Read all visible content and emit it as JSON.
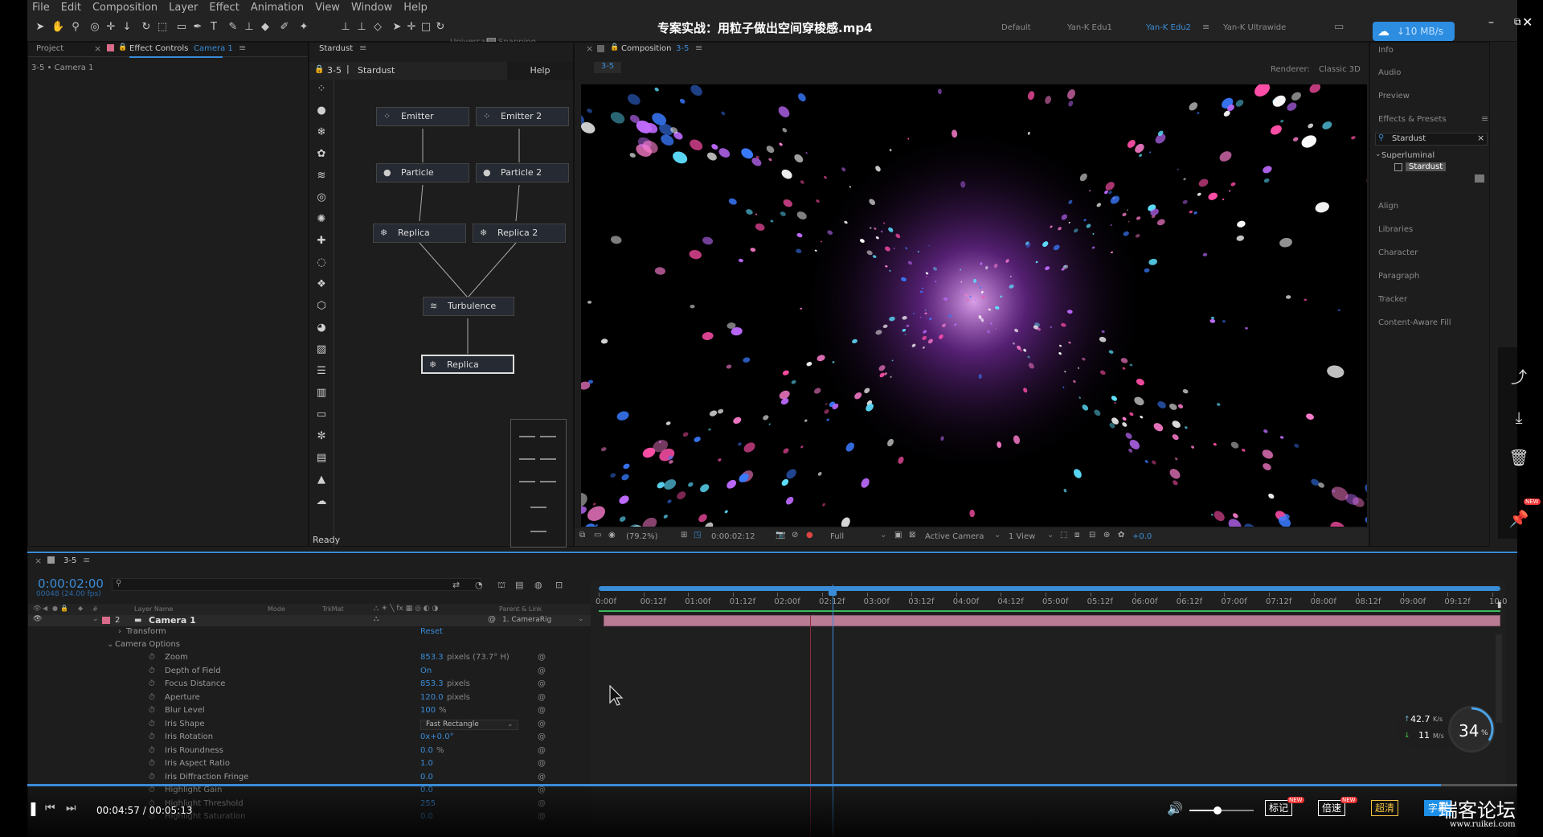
{
  "menu": [
    "File",
    "Edit",
    "Composition",
    "Layer",
    "Effect",
    "Animation",
    "View",
    "Window",
    "Help"
  ],
  "toolbar": {
    "universal": "Universal",
    "snapping": "Snapping"
  },
  "video_title": "专案实战：用粒子做出空间穿梭感.mp4",
  "workspaces": [
    "Default",
    "Yan-K Edu1",
    "Yan-K Edu2",
    "Yan-K Ultrawide"
  ],
  "speed_badge": "↓10 MB/s",
  "left_panel": {
    "tab_project": "Project",
    "tab_effect": "Effect Controls",
    "tab_effect_target": "Camera 1",
    "breadcrumb": "3-5 • Camera 1"
  },
  "stardust": {
    "tab": "Stardust",
    "comp": "3-5",
    "name": "Stardust",
    "help": "Help",
    "status": "Ready",
    "nodes": {
      "emitter": "Emitter",
      "emitter2": "Emitter 2",
      "particle": "Particle",
      "particle2": "Particle 2",
      "replica": "Replica",
      "replica2": "Replica 2",
      "turbulence": "Turbulence",
      "replica3": "Replica"
    }
  },
  "composition": {
    "tab": "Composition",
    "tab_target": "3-5",
    "subtab": "3-5",
    "renderer_label": "Renderer:",
    "renderer": "Classic 3D",
    "footer": {
      "zoom": "(79.2%)",
      "time": "0:00:02:12",
      "quality": "Full",
      "camera": "Active Camera",
      "views": "1 View",
      "exposure": "+0.0"
    }
  },
  "right_panel": {
    "items": [
      "Info",
      "Audio",
      "Preview",
      "Effects & Presets"
    ],
    "search": "Stardust",
    "folder": "Superluminal",
    "effect": "Stardust",
    "items2": [
      "Align",
      "Libraries",
      "Character",
      "Paragraph",
      "Tracker",
      "Content-Aware Fill"
    ]
  },
  "timeline": {
    "tab": "3-5",
    "time": "0:00:02:00",
    "frames": "00048 (24.00 fps)",
    "headers": {
      "layer_name": "Layer Name",
      "mode": "Mode",
      "trkmat": "TrkMat",
      "parent": "Parent & Link"
    },
    "layer": {
      "num": "2",
      "name": "Camera 1",
      "parent": "1. CameraRig"
    },
    "transform": "Transform",
    "reset": "Reset",
    "camera_options": "Camera Options",
    "props": [
      {
        "name": "Zoom",
        "value": "853.3",
        "unit": "pixels (73.7° H)"
      },
      {
        "name": "Depth of Field",
        "value": "On",
        "unit": ""
      },
      {
        "name": "Focus Distance",
        "value": "853.3",
        "unit": "pixels"
      },
      {
        "name": "Aperture",
        "value": "120.0",
        "unit": "pixels"
      },
      {
        "name": "Blur Level",
        "value": "100",
        "unit": "%"
      },
      {
        "name": "Iris Shape",
        "value": "Fast Rectangle",
        "unit": ""
      },
      {
        "name": "Iris Rotation",
        "value": "0x+0.0°",
        "unit": ""
      },
      {
        "name": "Iris Roundness",
        "value": "0.0",
        "unit": "%"
      },
      {
        "name": "Iris Aspect Ratio",
        "value": "1.0",
        "unit": ""
      },
      {
        "name": "Iris Diffraction Fringe",
        "value": "0.0",
        "unit": ""
      },
      {
        "name": "Highlight Gain",
        "value": "0.0",
        "unit": ""
      },
      {
        "name": "Highlight Threshold",
        "value": "255",
        "unit": ""
      },
      {
        "name": "Highlight Saturation",
        "value": "0.0",
        "unit": ""
      }
    ],
    "ruler": [
      "0:00f",
      "00:12f",
      "01:00f",
      "01:12f",
      "02:00f",
      "02:12f",
      "03:00f",
      "03:12f",
      "04:00f",
      "04:12f",
      "05:00f",
      "05:12f",
      "06:00f",
      "06:12f",
      "07:00f",
      "07:12f",
      "08:00f",
      "08:12f",
      "09:00f",
      "09:12f",
      "10:0"
    ]
  },
  "net_widget": {
    "up": "42.7",
    "up_unit": "K/s",
    "down": "11",
    "down_unit": "M/s",
    "percent": "34",
    "percent_unit": "%"
  },
  "player": {
    "time": "00:04:57 / 00:05:13",
    "progress": 0.949,
    "btn_mark": "标记",
    "btn_speed": "倍速",
    "btn_quality": "超清",
    "btn_sub": "字幕",
    "badge_new": "NEW"
  },
  "watermark": {
    "cn": "瑞客论坛",
    "url": "www.ruikei.com"
  }
}
